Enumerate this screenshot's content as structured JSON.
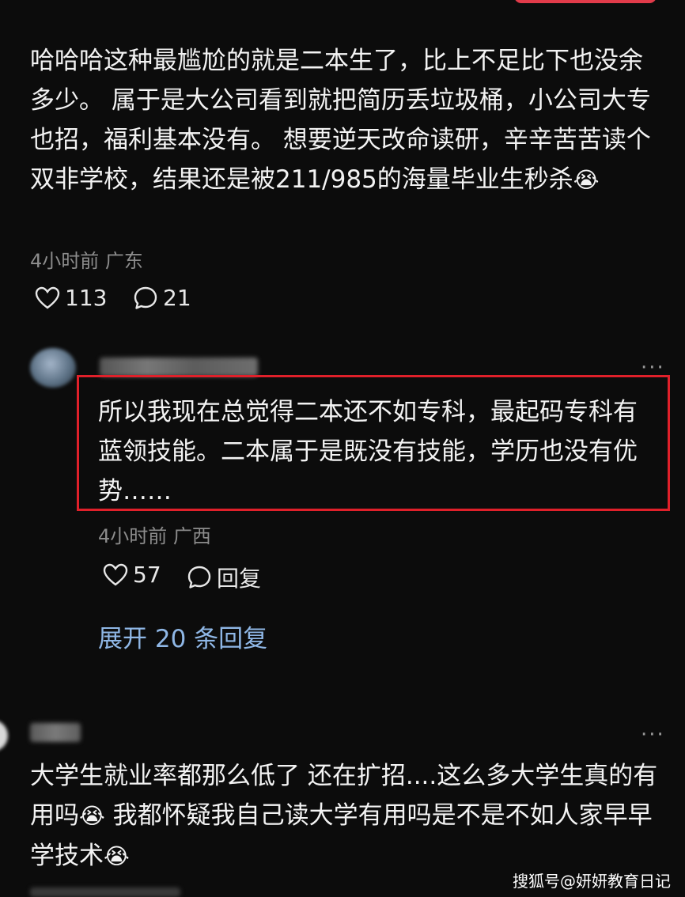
{
  "comment1": {
    "text": "哈哈哈这种最尴尬的就是二本生了，比上不足比下也没余多少。 属于是大公司看到就把简历丢垃圾桶，小公司大专也招，福利基本没有。 想要逆天改命读研，辛辛苦苦读个双非学校，结果还是被211/985的海量毕业生秒杀",
    "emoji": "😭",
    "meta": "4小时前 广东",
    "likes": "113",
    "comments": "21"
  },
  "reply1": {
    "text": "所以我现在总觉得二本还不如专科，最起码专科有蓝领技能。二本属于是既没有技能，学历也没有优势……",
    "meta": "4小时前 广西",
    "likes": "57",
    "reply_label": "回复",
    "more": "···",
    "expand": "展开 20 条回复"
  },
  "comment2": {
    "text_a": "大学生就业率都那么低了 还在扩招....这么多大学生真的有用吗",
    "emoji_a": "😭",
    "text_b": " 我都怀疑我自己读大学有用吗是不是不如人家早早学技术",
    "emoji_b": "😭",
    "more": "···"
  },
  "watermark": "搜狐号@妍妍教育日记",
  "colors": {
    "background": "#0c0c0c",
    "highlight_box": "#e0202a",
    "link": "#8fb7e6",
    "meta": "#8c8c8c"
  },
  "icons": [
    "heart-icon",
    "comment-icon",
    "more-icon"
  ]
}
